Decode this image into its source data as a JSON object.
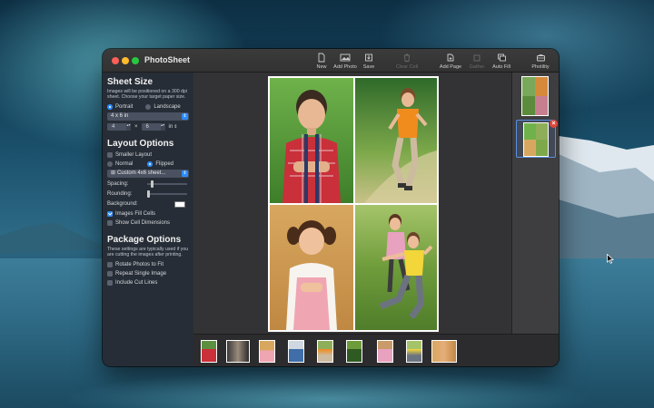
{
  "app": {
    "title": "PhotoSheet"
  },
  "toolbar": {
    "new": "New",
    "add_photo": "Add Photo",
    "save": "Save",
    "clear_cell": "Clear Cell",
    "add_page": "Add Page",
    "gather": "Gather",
    "auto_fill": "Auto Fill",
    "photility": "Photility"
  },
  "sheet_size": {
    "title": "Sheet Size",
    "description": "Images will be positioned on a 300 dpi sheet. Choose your target paper size.",
    "portrait": "Portrait",
    "landscape": "Landscape",
    "paper": "4 x 6 in",
    "width": "4",
    "height": "6",
    "times": "×",
    "unit": "in"
  },
  "layout": {
    "title": "Layout Options",
    "smaller_layout": "Smaller Layout",
    "normal": "Normal",
    "flipped": "Flipped",
    "preset": "Custom 4x6 sheet...",
    "spacing": "Spacing:",
    "spacing_value": 0.1,
    "rounding": "Rounding:",
    "rounding_value": 0.0,
    "background": "Background:",
    "background_color": "#ffffff",
    "images_fill_cells": "Images Fill Cells",
    "show_cell_dimensions": "Show Cell Dimensions"
  },
  "package": {
    "title": "Package Options",
    "description": "These settings are typically used if you are cutting the images after printing.",
    "rotate": "Rotate Photos to Fit",
    "repeat": "Repeat Single Image",
    "cut_lines": "Include Cut Lines"
  },
  "sheets_panel": {
    "delete_symbol": "×"
  },
  "colors": {
    "accent": "#2b8bff",
    "delete": "#e0453a"
  }
}
